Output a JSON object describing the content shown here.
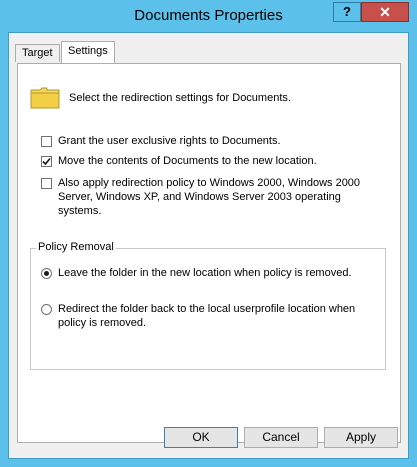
{
  "window": {
    "title": "Documents Properties",
    "help_label": "?",
    "close_label": "✕",
    "accent_color": "#5bc0ea"
  },
  "tabs": [
    {
      "label": "Target",
      "active": false
    },
    {
      "label": "Settings",
      "active": true
    }
  ],
  "settings": {
    "intro_icon": "folder-icon",
    "intro_text": "Select the redirection settings for Documents.",
    "options": [
      {
        "label": "Grant the user exclusive rights to Documents.",
        "checked": false
      },
      {
        "label": "Move the contents of Documents to the new location.",
        "checked": true
      },
      {
        "label_lines": [
          "Also apply redirection policy to Windows 2000, Windows 2000",
          "Server, Windows XP, and Windows Server 2003 operating",
          "systems."
        ],
        "checked": false
      }
    ],
    "policy_removal": {
      "legend": "Policy Removal",
      "choices": [
        {
          "label_lines": [
            "Leave the folder in the new location when policy is removed."
          ],
          "selected": true
        },
        {
          "label_lines": [
            "Redirect the folder back to the local userprofile location when",
            "policy is removed."
          ],
          "selected": false
        }
      ]
    }
  },
  "buttons": {
    "ok": "OK",
    "cancel": "Cancel",
    "apply": "Apply"
  }
}
